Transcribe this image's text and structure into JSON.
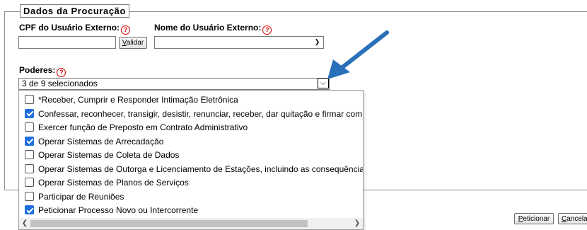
{
  "section": {
    "legend": "Dados da Procuração"
  },
  "cpf": {
    "label": "CPF do Usuário Externo:",
    "value": "",
    "validate_hotkey": "V",
    "validate_rest": "alidar"
  },
  "nome": {
    "label": "Nome do Usuário Externo:",
    "value": ""
  },
  "poderes": {
    "label": "Poderes:",
    "selected_text": "3 de 9 selecionados",
    "options": [
      {
        "label": "*Receber, Cumprir e Responder Intimação Eletrônica",
        "checked": false
      },
      {
        "label": "Confessar, reconhecer, transigir, desistir, renunciar, receber, dar quitação e firmar comp",
        "checked": true
      },
      {
        "label": "Exercer função de Preposto em Contrato Administrativo",
        "checked": false
      },
      {
        "label": "Operar Sistemas de Arrecadação",
        "checked": true
      },
      {
        "label": "Operar Sistemas de Coleta de Dados",
        "checked": false
      },
      {
        "label": "Operar Sistemas de Outorga e Licenciamento de Estações, incluindo as consequência",
        "checked": false
      },
      {
        "label": "Operar Sistemas de Planos de Serviços",
        "checked": false
      },
      {
        "label": "Participar de Reuniões",
        "checked": false
      },
      {
        "label": "Peticionar Processo Novo ou Intercorrente",
        "checked": true
      }
    ]
  },
  "icons": {
    "help": "question-circle-icon",
    "arrow": "annotation-arrow-icon",
    "chevron": "chevron-down-icon"
  },
  "colors": {
    "help": "#d40000",
    "checkbox": "#1f6fe0",
    "arrow": "#2a6fba"
  },
  "footer": {
    "peticionar_hotkey": "P",
    "peticionar_rest": "eticionar",
    "cancelar_hotkey": "C",
    "cancelar_rest": "ancela"
  }
}
